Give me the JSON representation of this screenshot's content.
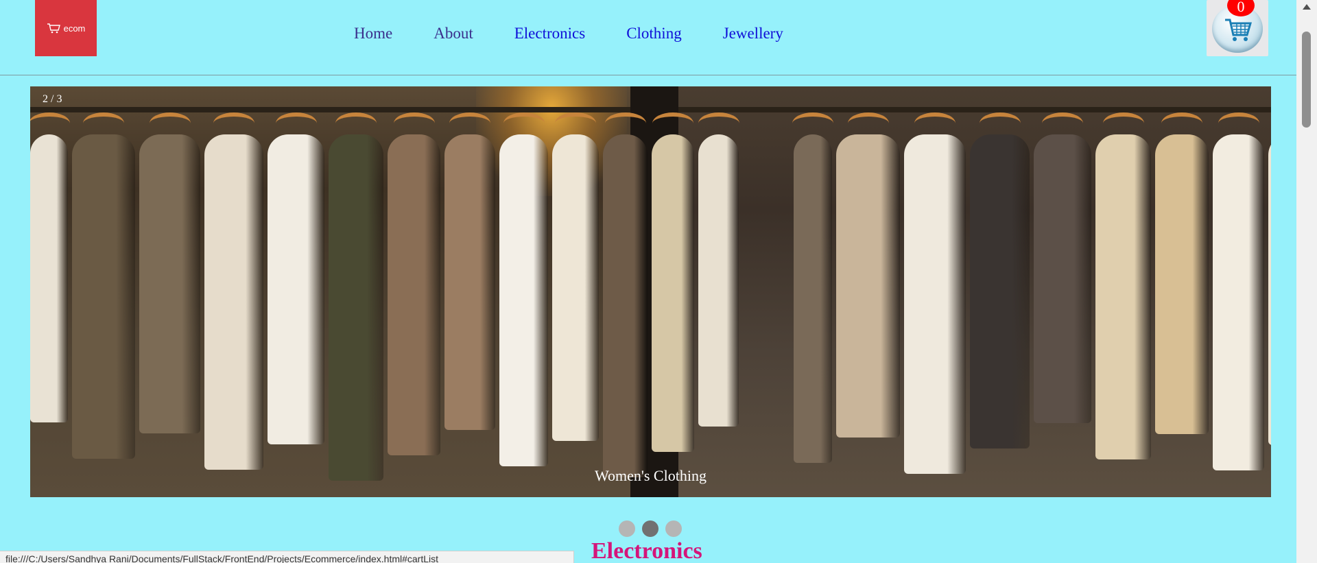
{
  "header": {
    "logo_text": "ecom",
    "nav": [
      {
        "label": "Home",
        "state": "visited"
      },
      {
        "label": "About",
        "state": "visited"
      },
      {
        "label": "Electronics",
        "state": "link"
      },
      {
        "label": "Clothing",
        "state": "link"
      },
      {
        "label": "Jewellery",
        "state": "link"
      }
    ],
    "cart_count": "0"
  },
  "slider": {
    "counter": "2 / 3",
    "caption": "Women's Clothing",
    "total_slides": 3,
    "active_slide": 2
  },
  "section_title": "Electronics",
  "status_url": "file:///C:/Users/Sandhya Rani/Documents/FullStack/FrontEnd/Projects/Ecommerce/index.html#cartList",
  "colors": {
    "background": "#96f1fb",
    "logo_bg": "#d9363e",
    "section_title": "#d4157a",
    "cart_badge": "#ff0000",
    "nav_link": "#1010d8",
    "nav_visited": "#3a2f8c"
  },
  "icons": [
    "cart-icon",
    "scroll-up-arrow-icon"
  ]
}
